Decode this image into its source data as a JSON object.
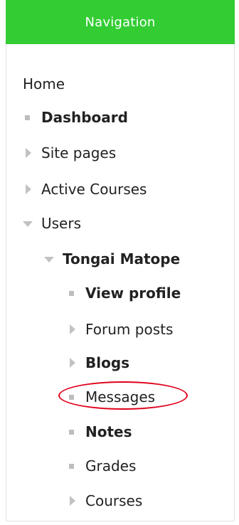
{
  "block": {
    "title": "Navigation"
  },
  "nav": {
    "home": "Home",
    "dashboard": "Dashboard",
    "site_pages": "Site pages",
    "active_courses": "Active Courses",
    "users": "Users",
    "user_name": "Tongai Matope",
    "view_profile": "View profile",
    "forum_posts": "Forum posts",
    "blogs": "Blogs",
    "messages": "Messages",
    "notes": "Notes",
    "grades": "Grades",
    "courses": "Courses"
  },
  "colors": {
    "header_bg": "#33cc33",
    "annotation_ring": "#e0001a"
  }
}
